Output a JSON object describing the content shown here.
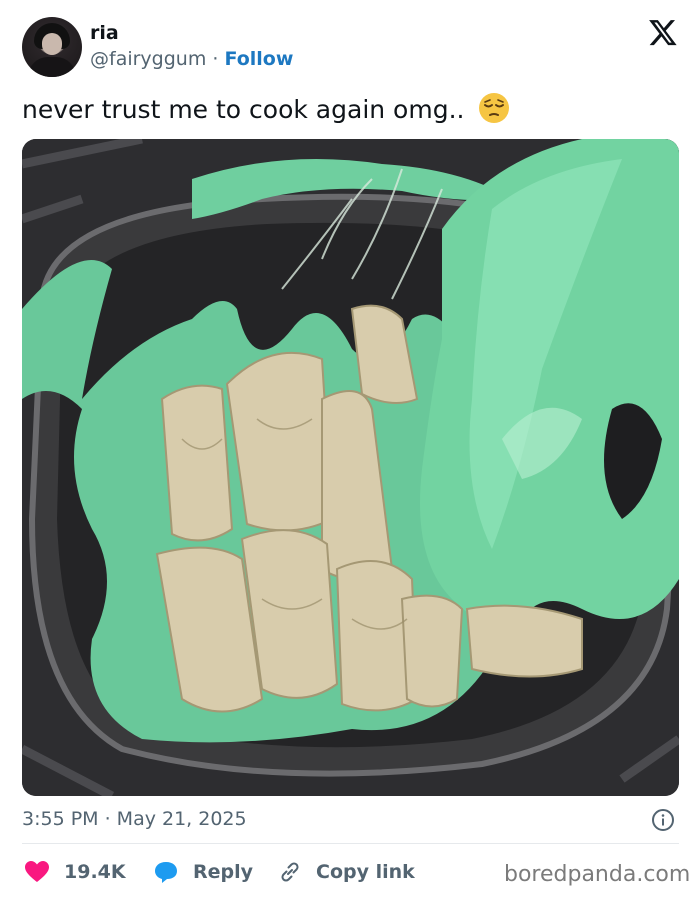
{
  "author": {
    "name": "ria",
    "handle": "@fairyggum",
    "separator": "·",
    "follow_label": "Follow"
  },
  "tweet": {
    "text": "never trust me to cook again omg..",
    "emoji": "pensive-face-emoji"
  },
  "photo": {
    "subject": "dumplings-in-pan-with-melted-green-plastic"
  },
  "meta": {
    "timestamp": "3:55 PM · May 21, 2025"
  },
  "actions": {
    "like_count": "19.4K",
    "reply_label": "Reply",
    "copy_label": "Copy link"
  },
  "watermark": "boredpanda.com",
  "icons": [
    "x-logo-icon",
    "info-icon",
    "heart-icon",
    "reply-bubble-icon",
    "link-icon"
  ],
  "colors": {
    "follow": "#1d78c1",
    "like": "#f91880",
    "reply": "#1d9bf0",
    "text": "#0f1419",
    "muted": "#536471"
  }
}
